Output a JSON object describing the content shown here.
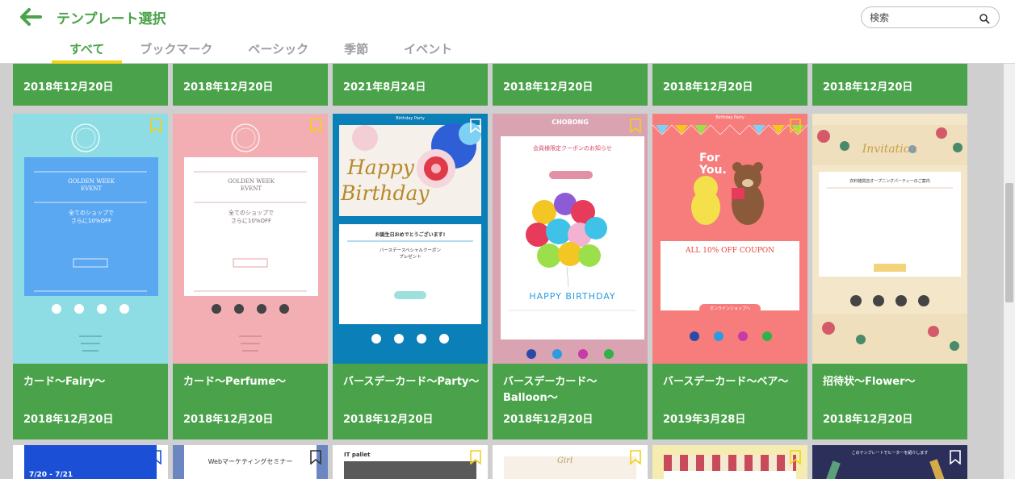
{
  "header": {
    "title": "テンプレート選択",
    "search_placeholder": "検索"
  },
  "tabs": [
    {
      "label": "すべて",
      "active": true
    },
    {
      "label": "ブックマーク",
      "active": false
    },
    {
      "label": "ベーシック",
      "active": false
    },
    {
      "label": "季節",
      "active": false
    },
    {
      "label": "イベント",
      "active": false
    }
  ],
  "top_row": [
    {
      "date": "2018年12月20日"
    },
    {
      "date": "2018年12月20日"
    },
    {
      "date": "2021年8月24日"
    },
    {
      "date": "2018年12月20日"
    },
    {
      "date": "2018年12月20日"
    },
    {
      "date": "2018年12月20日"
    }
  ],
  "templates": [
    {
      "name": "カード〜Fairy〜",
      "date": "2018年12月20日",
      "thumb": {
        "heading": "GOLDEN WEEK\nEVENT",
        "body": "全てのショップで\nさらに10%OFF"
      }
    },
    {
      "name": "カード〜Perfume〜",
      "date": "2018年12月20日",
      "thumb": {
        "heading": "GOLDEN WEEK\nEVENT",
        "body": "全てのショップで\nさらに10%OFF"
      }
    },
    {
      "name": "バースデーカード〜Party〜",
      "date": "2018年12月20日",
      "thumb": {
        "brand": "Birthday Party",
        "script1": "Happy",
        "script2": "Birthday",
        "msg": "お誕生日おめでとうございます!",
        "coupon": "バースデースペシャルクーポン\nプレゼント"
      }
    },
    {
      "name": "バースデーカード〜Balloon〜",
      "date": "2018年12月20日",
      "thumb": {
        "brand": "CHOBONG",
        "heading": "会員様限定クーポンのお知らせ",
        "banner": "HAPPY BIRTHDAY"
      }
    },
    {
      "name": "バースデーカード〜ベア〜",
      "date": "2019年3月28日",
      "thumb": {
        "brand": "Birthday Party",
        "for_you": "For\nYou.",
        "coupon": "ALL 10% OFF COUPON",
        "cta": "オンラインショップへ"
      }
    },
    {
      "name": "招待状〜Flower〜",
      "date": "2018年12月20日",
      "thumb": {
        "script": "Invitation",
        "heading": "衣料雑貨店オープニングパーティーのご案内"
      }
    }
  ],
  "bottom_row": [
    {
      "label": "7/20 - 7/21"
    },
    {
      "label": "Webマーケティングセミナー"
    },
    {
      "label": "IT pallet"
    },
    {
      "label": "Girl"
    },
    {
      "label": ""
    },
    {
      "label": "このテンプレートでヒーターを紹介します"
    }
  ],
  "colors": {
    "accent": "#4aa34a",
    "tab_underline": "#f2d01b",
    "bookmark": "#f2d01b"
  }
}
